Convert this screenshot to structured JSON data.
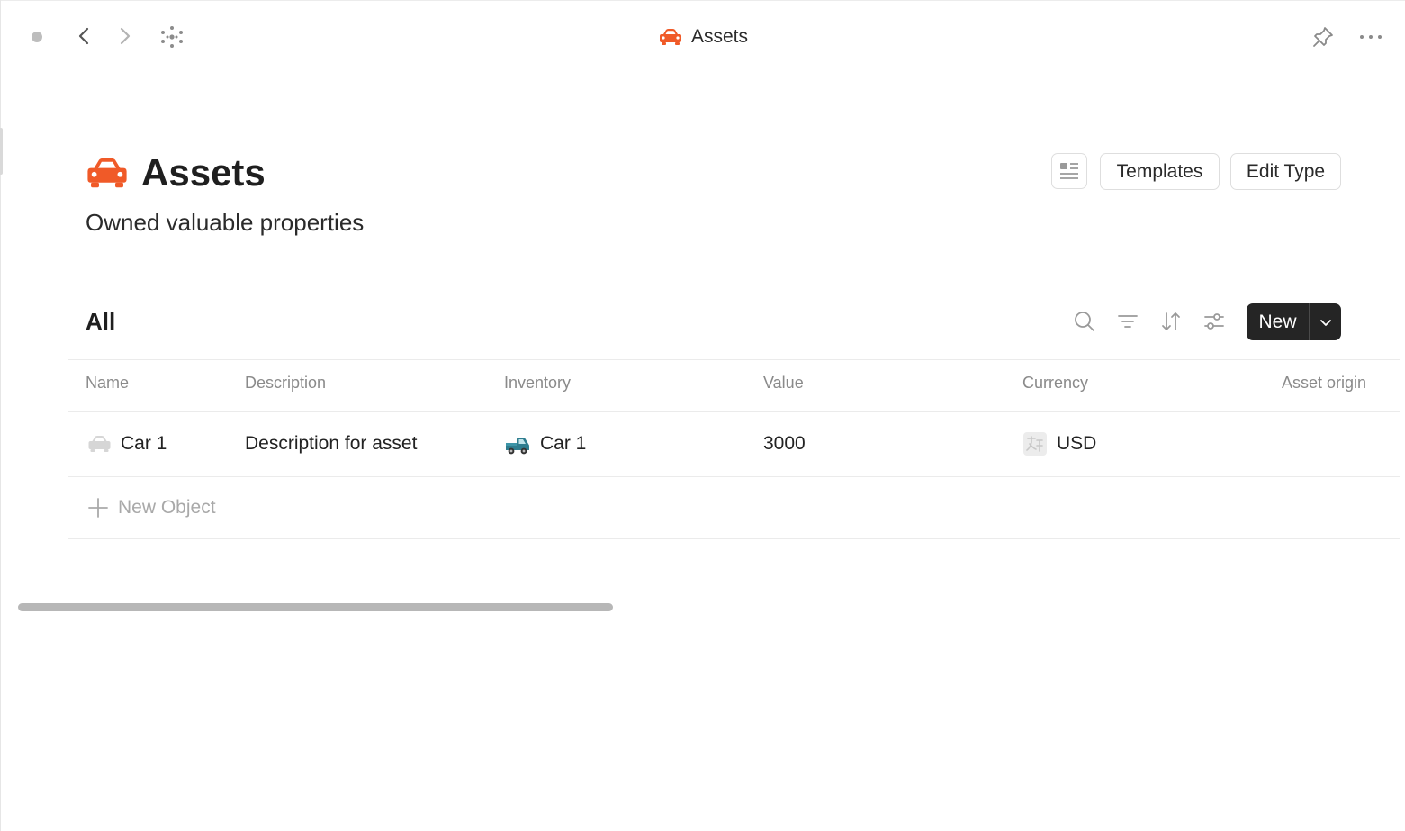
{
  "topbar": {
    "title": "Assets",
    "icons": [
      "status-dot",
      "chevron-left-icon",
      "chevron-right-icon",
      "graph-icon",
      "car-icon",
      "pin-icon",
      "more-icon"
    ]
  },
  "header": {
    "title": "Assets",
    "description": "Owned valuable properties",
    "icon": "car-icon",
    "accent_color": "#F05A28",
    "buttons": {
      "templates": "Templates",
      "edit_type": "Edit Type"
    }
  },
  "view": {
    "title": "All",
    "new_label": "New"
  },
  "table": {
    "columns": [
      "Name",
      "Description",
      "Inventory",
      "Value",
      "Currency",
      "Asset origin"
    ],
    "rows": [
      {
        "name": "Car 1",
        "description": "Description for asset",
        "inventory": "Car 1",
        "value": "3000",
        "currency": "USD",
        "asset_origin": ""
      }
    ],
    "new_object_label": "New Object"
  }
}
